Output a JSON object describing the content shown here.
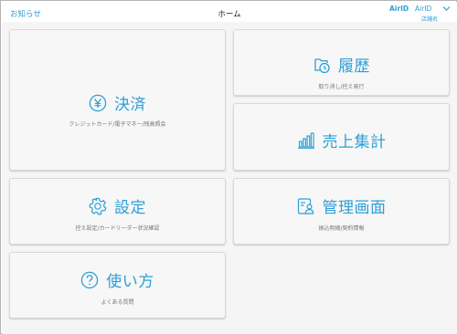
{
  "header": {
    "notice_label": "お知らせ",
    "title": "ホーム",
    "airid_logo": "AirID",
    "account_name": "AirID",
    "store_name": "店舗名"
  },
  "cards": {
    "payment": {
      "title": "決済",
      "subtitle": "クレジットカード/電子マネー/残高照会",
      "icon": "yen-icon"
    },
    "history": {
      "title": "履歴",
      "subtitle": "取り消し/控え発行",
      "icon": "history-icon"
    },
    "sales": {
      "title": "売上集計",
      "subtitle": "",
      "icon": "bar-chart-icon"
    },
    "settings": {
      "title": "設定",
      "subtitle": "控え設定/カードリーダー状況確認",
      "icon": "gear-icon"
    },
    "admin": {
      "title": "管理画面",
      "subtitle": "振込明細/契約情報",
      "icon": "admin-profile-icon"
    },
    "help": {
      "title": "使い方",
      "subtitle": "よくある質問",
      "icon": "question-icon"
    }
  },
  "colors": {
    "accent": "#2d9fd8",
    "background": "#f5f5f5",
    "card": "#f7f7f7"
  }
}
